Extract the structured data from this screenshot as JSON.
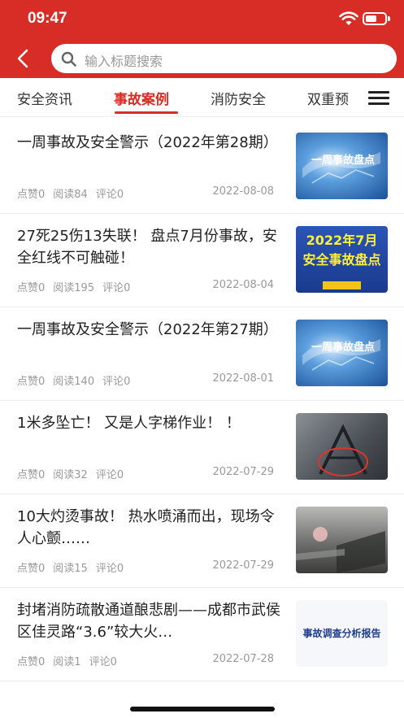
{
  "status_bar": {
    "time": "09:47"
  },
  "search": {
    "placeholder": "输入标题搜索"
  },
  "tabs": [
    {
      "label": "安全资讯"
    },
    {
      "label": "事故案例"
    },
    {
      "label": "消防安全"
    },
    {
      "label": "双重预"
    }
  ],
  "articles": [
    {
      "title": "一周事故及安全警示（2022年第28期）",
      "likes": "点赞0",
      "reads": "阅读84",
      "comments": "评论0",
      "date": "2022-08-08",
      "thumb_text": "一周事故盘点"
    },
    {
      "title": "27死25伤13失联！ 盘点7月份事故，安全红线不可触碰！",
      "likes": "点赞0",
      "reads": "阅读195",
      "comments": "评论0",
      "date": "2022-08-04",
      "thumb_text": "2022年7月 安全事故盘点"
    },
    {
      "title": "一周事故及安全警示（2022年第27期）",
      "likes": "点赞0",
      "reads": "阅读140",
      "comments": "评论0",
      "date": "2022-08-01",
      "thumb_text": "一周事故盘点"
    },
    {
      "title": "1米多坠亡！ 又是人字梯作业！ ！",
      "likes": "点赞0",
      "reads": "阅读32",
      "comments": "评论0",
      "date": "2022-07-29",
      "thumb_text": ""
    },
    {
      "title": "10大灼烫事故！ 热水喷涌而出，现场令人心颤……",
      "likes": "点赞0",
      "reads": "阅读15",
      "comments": "评论0",
      "date": "2022-07-29",
      "thumb_text": ""
    },
    {
      "title": "封堵消防疏散通道酿悲剧——成都市武侯区佳灵路“3.6”较大火…",
      "likes": "点赞0",
      "reads": "阅读1",
      "comments": "评论0",
      "date": "2022-07-28",
      "thumb_text": "事故调查分析报告"
    }
  ],
  "colors": {
    "brand": "#d82d26",
    "text": "#222222",
    "meta": "#999999"
  }
}
